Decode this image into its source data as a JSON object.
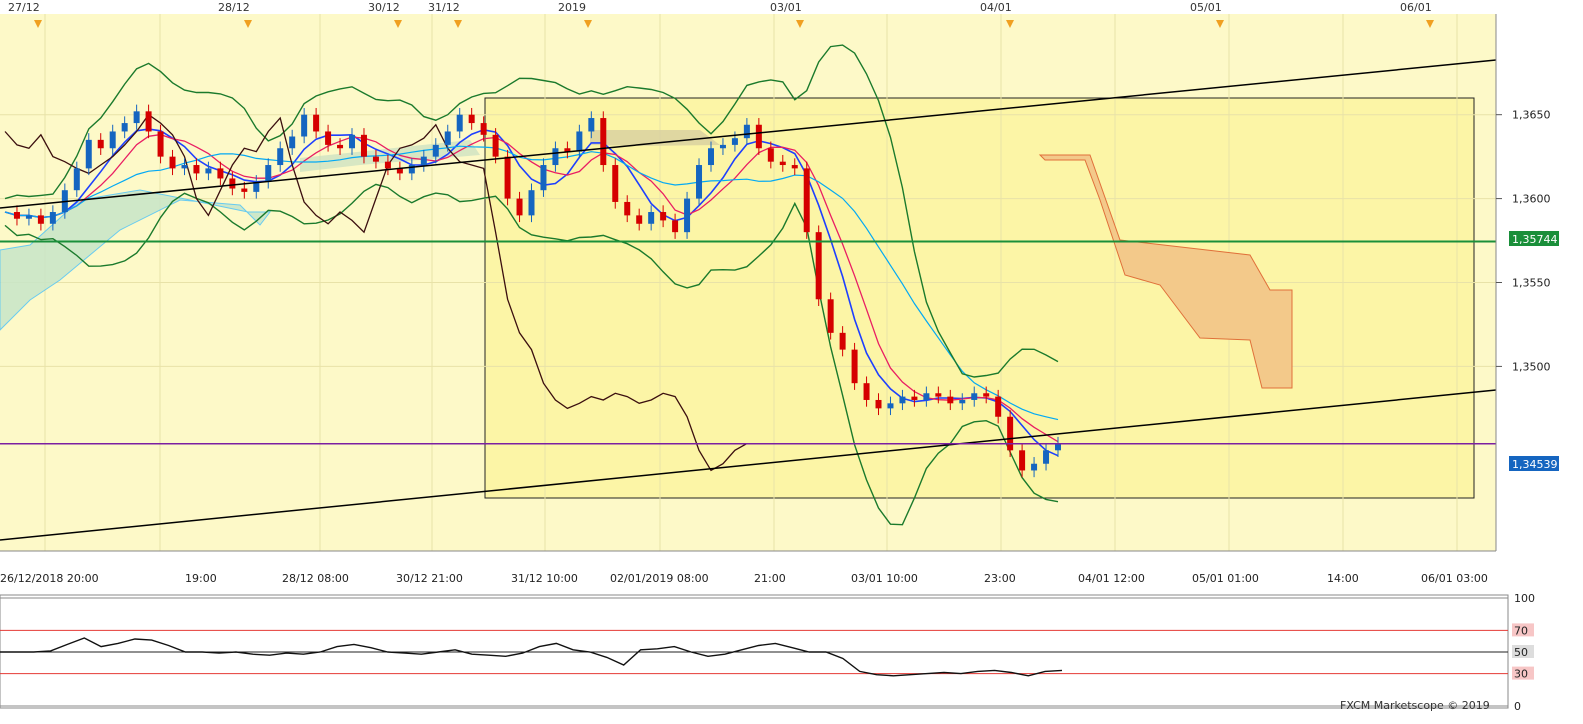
{
  "chart_data": {
    "type": "candlestick",
    "instrument_note": "",
    "top_date_markers": [
      "27/12",
      "28/12",
      "30/12",
      "31/12",
      "2019",
      "03/01",
      "04/01",
      "05/01",
      "06/01"
    ],
    "bottom_time_labels": [
      "26/12/2018 20:00",
      "19:00",
      "28/12 08:00",
      "30/12 21:00",
      "31/12 10:00",
      "02/01/2019 08:00",
      "21:00",
      "03/01 10:00",
      "23:00",
      "04/01 12:00",
      "05/01 01:00",
      "14:00",
      "06/01 03:00"
    ],
    "y_ticks": [
      "1,3650",
      "1,3600",
      "1,3550",
      "1,3500"
    ],
    "ylim": [
      1.339,
      1.371
    ],
    "current_price_label": "1,34539",
    "current_price": 1.34539,
    "level_label": "1,35744",
    "level_price": 1.35744,
    "close_series": [
      1.3592,
      1.3588,
      1.359,
      1.3585,
      1.3592,
      1.3605,
      1.3618,
      1.3635,
      1.363,
      1.364,
      1.3645,
      1.3652,
      1.364,
      1.3625,
      1.3618,
      1.362,
      1.3615,
      1.3618,
      1.3612,
      1.3606,
      1.3604,
      1.361,
      1.362,
      1.363,
      1.3637,
      1.365,
      1.364,
      1.3632,
      1.363,
      1.3638,
      1.3625,
      1.3622,
      1.3618,
      1.3615,
      1.362,
      1.3625,
      1.3632,
      1.364,
      1.365,
      1.3645,
      1.3638,
      1.3625,
      1.36,
      1.359,
      1.3605,
      1.362,
      1.363,
      1.3628,
      1.364,
      1.3648,
      1.362,
      1.3598,
      1.359,
      1.3585,
      1.3592,
      1.3587,
      1.358,
      1.36,
      1.362,
      1.363,
      1.3632,
      1.3636,
      1.3644,
      1.363,
      1.3622,
      1.362,
      1.3618,
      1.358,
      1.354,
      1.352,
      1.351,
      1.349,
      1.348,
      1.3475,
      1.3478,
      1.3482,
      1.348,
      1.3484,
      1.3482,
      1.3478,
      1.348,
      1.3484,
      1.3482,
      1.347,
      1.345,
      1.3438,
      1.3442,
      1.345,
      1.3454
    ],
    "rsi": {
      "levels": [
        "100",
        "70",
        "50",
        "30",
        "0"
      ],
      "values": [
        50,
        50,
        50,
        51,
        57,
        63,
        55,
        58,
        62,
        61,
        56,
        50,
        50,
        49,
        50,
        48,
        47,
        49,
        48,
        50,
        55,
        57,
        54,
        50,
        49,
        48,
        50,
        52,
        48,
        47,
        46,
        49,
        55,
        58,
        52,
        50,
        45,
        38,
        52,
        53,
        55,
        50,
        46,
        48,
        52,
        56,
        58,
        54,
        50,
        50,
        44,
        32,
        29,
        28,
        29,
        30,
        31,
        30,
        32,
        33,
        31,
        28,
        32,
        33
      ]
    },
    "credit": "FXCM Marketscope © 2019"
  }
}
